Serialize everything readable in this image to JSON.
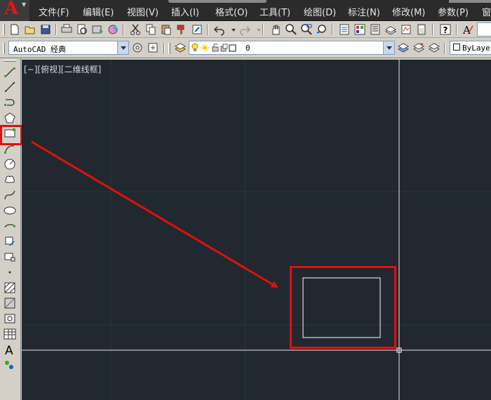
{
  "menubar": {
    "items": [
      "文件(F)",
      "编辑(E)",
      "视图(V)",
      "插入(I)",
      "格式(O)",
      "工具(T)",
      "绘图(D)",
      "标注(N)",
      "修改(M)",
      "参数(P)",
      "窗"
    ]
  },
  "workspace": {
    "value": "AutoCAD 经典"
  },
  "layer": {
    "value": "0"
  },
  "linetype": {
    "value": "ByLaye"
  },
  "viewport": {
    "label": "[−][俯视][二维线框]"
  },
  "colors": {
    "canvas_bg": "#212830",
    "highlight": "#e01010",
    "crosshair": "#ffffff",
    "menubar_bg": "#2b2b2b"
  },
  "left_toolbar": {
    "tools": [
      "line-icon",
      "construction-line-icon",
      "polyline-icon",
      "polygon-icon",
      "rectangle-icon",
      "arc-icon",
      "circle-icon",
      "revision-cloud-icon",
      "spline-icon",
      "ellipse-icon",
      "ellipse-arc-icon",
      "insert-block-icon",
      "make-block-icon",
      "point-icon",
      "hatch-icon",
      "gradient-icon",
      "region-icon",
      "table-icon",
      "multiline-text-icon",
      "add-selected-icon"
    ]
  }
}
